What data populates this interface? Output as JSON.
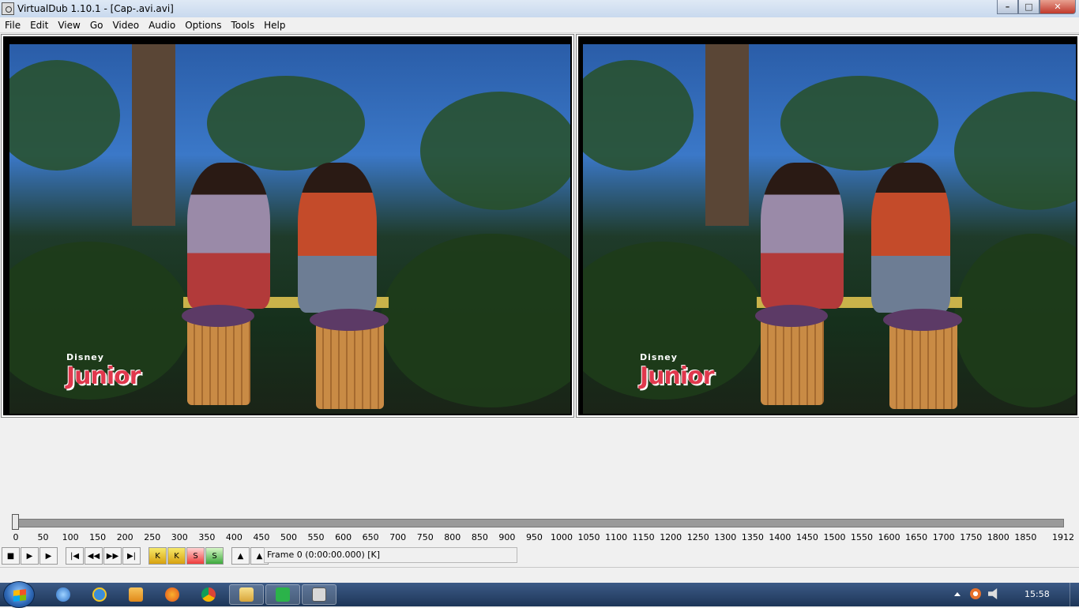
{
  "window": {
    "title": "VirtualDub 1.10.1 - [Cap-.avi.avi]",
    "controls": {
      "minimize": "–",
      "maximize": "□",
      "close": "✕"
    }
  },
  "menu": [
    "File",
    "Edit",
    "View",
    "Go",
    "Video",
    "Audio",
    "Options",
    "Tools",
    "Help"
  ],
  "video": {
    "input_logo": "Junior",
    "input_logo_small": "Disney",
    "output_logo": "Junior",
    "output_logo_small": "Disney"
  },
  "timeline": {
    "ticks": [
      "0",
      "50",
      "100",
      "150",
      "200",
      "250",
      "300",
      "350",
      "400",
      "450",
      "500",
      "550",
      "600",
      "650",
      "700",
      "750",
      "800",
      "850",
      "900",
      "950",
      "1000",
      "1050",
      "1100",
      "1150",
      "1200",
      "1250",
      "1300",
      "1350",
      "1400",
      "1450",
      "1500",
      "1550",
      "1600",
      "1650",
      "1700",
      "1750",
      "1800",
      "1850",
      "1912"
    ],
    "position_fraction": 0.0
  },
  "toolbar": {
    "buttons": [
      {
        "name": "stop-button",
        "glyph": "■"
      },
      {
        "name": "play-input-button",
        "glyph": "▶"
      },
      {
        "name": "play-output-button",
        "glyph": "▶"
      },
      {
        "name": "start-button",
        "glyph": "|◀"
      },
      {
        "name": "prev-frame-button",
        "glyph": "◀◀"
      },
      {
        "name": "next-frame-button",
        "glyph": "▶▶"
      },
      {
        "name": "end-button",
        "glyph": "▶|"
      },
      {
        "name": "prev-keyframe-button",
        "glyph": "K"
      },
      {
        "name": "next-keyframe-button",
        "glyph": "K"
      },
      {
        "name": "prev-scene-button",
        "glyph": "S"
      },
      {
        "name": "next-scene-button",
        "glyph": "S"
      },
      {
        "name": "mark-in-button",
        "glyph": "▲"
      },
      {
        "name": "mark-out-button",
        "glyph": "▲"
      }
    ],
    "frame_label": "Frame 0 (0:00:00.000) [K]"
  },
  "taskbar": {
    "clock": "15:58",
    "apps": [
      "network-icon",
      "ie-icon",
      "media-player-icon",
      "firefox-icon",
      "chrome-icon",
      "explorer-icon",
      "notepad-icon",
      "virtualdub-icon"
    ]
  }
}
